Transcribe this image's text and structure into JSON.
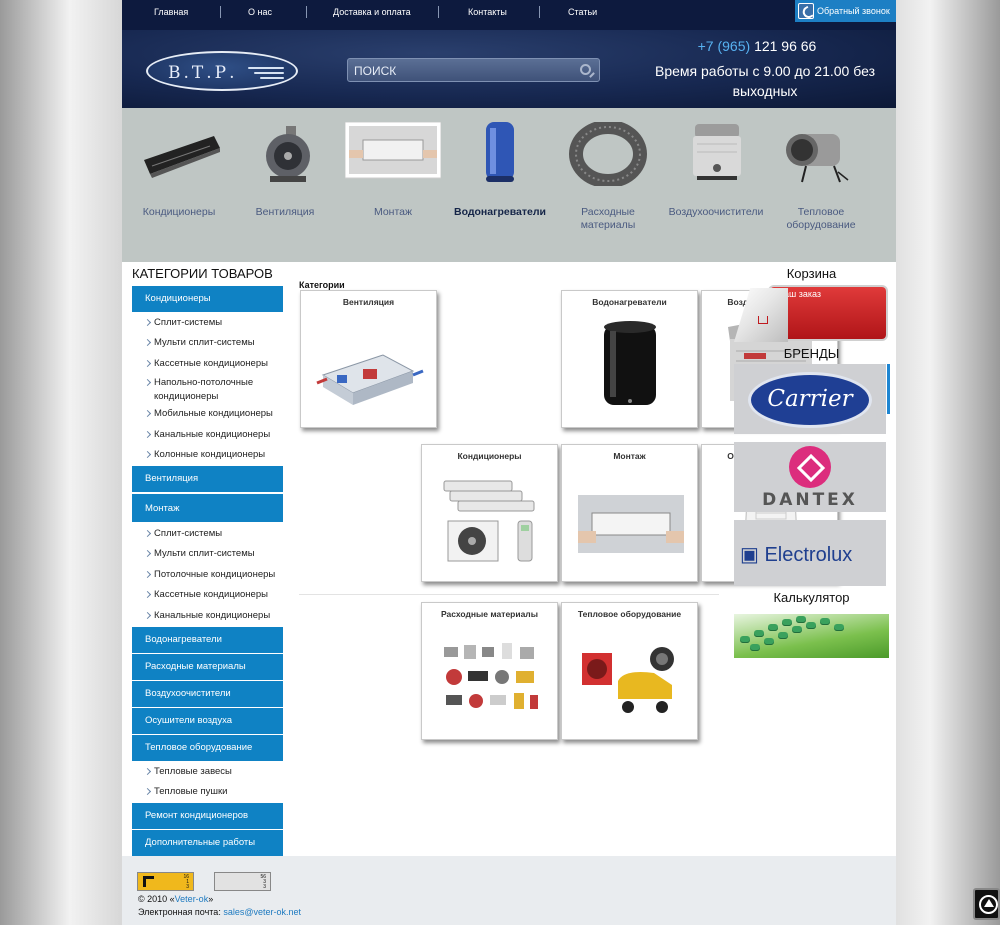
{
  "topnav": {
    "items": [
      "Главная",
      "О нас",
      "Доставка и оплата",
      "Контакты",
      "Статьи"
    ],
    "callback_label": "Обратный звонок"
  },
  "header": {
    "logo_text": "В.Т.Р.",
    "search_placeholder": "ПОИСК",
    "phone_code": "+7 (965)",
    "phone_number": "121 96 66",
    "hours": "Время работы с 9.00 до 21.00 без выходных"
  },
  "categories_band": {
    "items": [
      {
        "label": "Кондиционеры",
        "icon": "air-conditioner-image"
      },
      {
        "label": "Вентиляция",
        "icon": "ventilation-fan-image"
      },
      {
        "label": "Монтаж",
        "icon": "installation-image"
      },
      {
        "label": "Водонагреватели",
        "icon": "water-heater-image",
        "active": true
      },
      {
        "label": "Расходные материалы",
        "icon": "pipe-coil-image"
      },
      {
        "label": "Воздухоочистители",
        "icon": "air-purifier-image"
      },
      {
        "label": "Тепловое оборудование",
        "icon": "heat-gun-image"
      }
    ]
  },
  "sidebar": {
    "title": "КАТЕГОРИИ ТОВАРОВ",
    "main": [
      "Кондиционеры",
      "Вентиляция",
      "Монтаж",
      "Водонагреватели",
      "Расходные материалы",
      "Воздухоочистители",
      "Осушители воздуха",
      "Тепловое оборудование",
      "Ремонт кондиционеров",
      "Дополнительные работы"
    ],
    "sub_conditioners": [
      "Сплит-системы",
      "Мульти сплит-системы",
      "Кассетные кондиционеры",
      "Напольно-потолочные кондиционеры",
      "Мобильные кондиционеры",
      "Канальные кондиционеры",
      "Колонные кондиционеры"
    ],
    "sub_montage": [
      "Сплит-системы",
      "Мульти сплит-системы",
      "Потолочные кондиционеры",
      "Кассетные кондиционеры",
      "Канальные кондиционеры"
    ],
    "sub_heating": [
      "Тепловые завесы",
      "Тепловые пушки"
    ]
  },
  "main": {
    "heading": "Категории",
    "cards": [
      "Вентиляция",
      "Водонагреватели",
      "Воздухоочистители",
      "Кондиционеры",
      "Монтаж",
      "Осушители воздуха",
      "Расходные материалы",
      "Тепловое оборудование"
    ]
  },
  "right": {
    "cart_title": "Корзина",
    "cart_label": "Ваш заказ",
    "brands_title": "БРЕНДЫ",
    "brands": [
      "Carrier",
      "DANTEX",
      "Electrolux"
    ],
    "calculator_title": "Калькулятор"
  },
  "footer": {
    "counter1": [
      "16",
      "1",
      "3"
    ],
    "counter2": [
      "56",
      "3",
      "3"
    ],
    "copyright_prefix": "© 2010 «",
    "copyright_link": "Veter-ok",
    "copyright_suffix": "»",
    "email_label": "Электронная почта: ",
    "email": "sales@veter-ok.net"
  },
  "colors": {
    "nav_bg": "#0d1a3e",
    "accent_blue": "#0f82c4",
    "cart_red": "#c01a1f"
  }
}
